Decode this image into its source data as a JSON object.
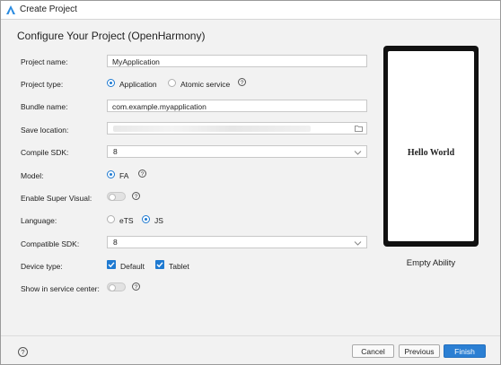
{
  "window": {
    "title": "Create Project"
  },
  "heading": "Configure Your Project (OpenHarmony)",
  "fields": {
    "project_name": {
      "label": "Project name:",
      "value": "MyApplication"
    },
    "project_type": {
      "label": "Project type:",
      "options": [
        "Application",
        "Atomic service"
      ],
      "selected": "Application"
    },
    "bundle_name": {
      "label": "Bundle name:",
      "value": "com.example.myapplication"
    },
    "save_location": {
      "label": "Save location:"
    },
    "compile_sdk": {
      "label": "Compile SDK:",
      "value": "8"
    },
    "model": {
      "label": "Model:",
      "options": [
        "FA"
      ],
      "selected": "FA"
    },
    "enable_super_visual": {
      "label": "Enable Super Visual:",
      "on": false
    },
    "language": {
      "label": "Language:",
      "options": [
        "eTS",
        "JS"
      ],
      "selected": "JS"
    },
    "compatible_sdk": {
      "label": "Compatible SDK:",
      "value": "8"
    },
    "device_type": {
      "label": "Device type:",
      "options": [
        "Default",
        "Tablet"
      ],
      "checked": [
        "Default",
        "Tablet"
      ]
    },
    "show_in_service_center": {
      "label": "Show in service center:",
      "on": false
    }
  },
  "preview": {
    "screen_text": "Hello World",
    "caption": "Empty Ability"
  },
  "buttons": {
    "cancel": "Cancel",
    "previous": "Previous",
    "finish": "Finish"
  },
  "help_glyph": "?",
  "colors": {
    "accent": "#1f7ad1",
    "primary_button": "#2b7fd3",
    "window_bg": "#f2f2f2"
  }
}
